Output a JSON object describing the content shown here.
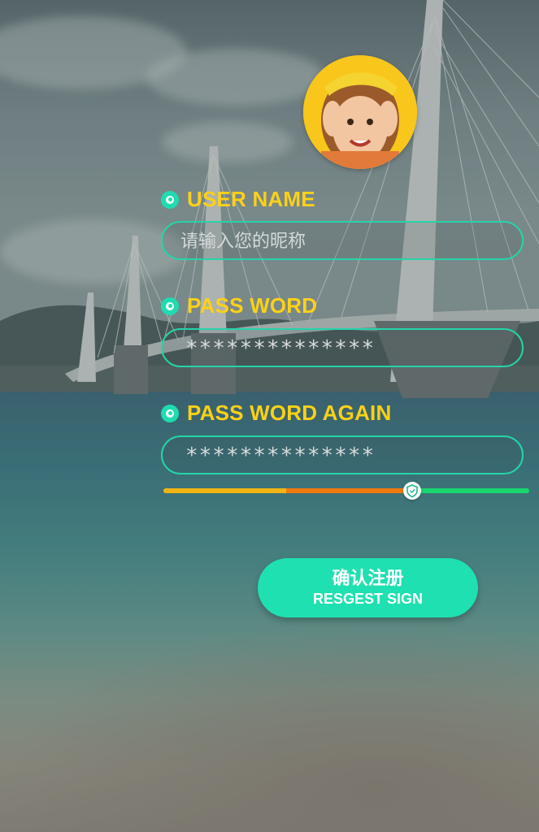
{
  "form": {
    "username": {
      "label": "USER NAME",
      "placeholder": "请输入您的昵称",
      "value": ""
    },
    "password": {
      "label": "PASS WORD",
      "masked_value": "**************"
    },
    "password_again": {
      "label": "PASS WORD AGAIN",
      "masked_value": "**************"
    },
    "strength": {
      "level_fraction": 0.68,
      "colors": [
        "#f0b412",
        "#f07a10",
        "#19d66e"
      ]
    },
    "submit": {
      "label_cn": "确认注册",
      "label_en": "RESGEST SIGN"
    }
  },
  "colors": {
    "accent": "#1fdcb0",
    "label": "#fcd116",
    "button": "#1fe0b0"
  },
  "icons": {
    "radio": "radio-dot-icon",
    "knob": "shield-icon"
  }
}
